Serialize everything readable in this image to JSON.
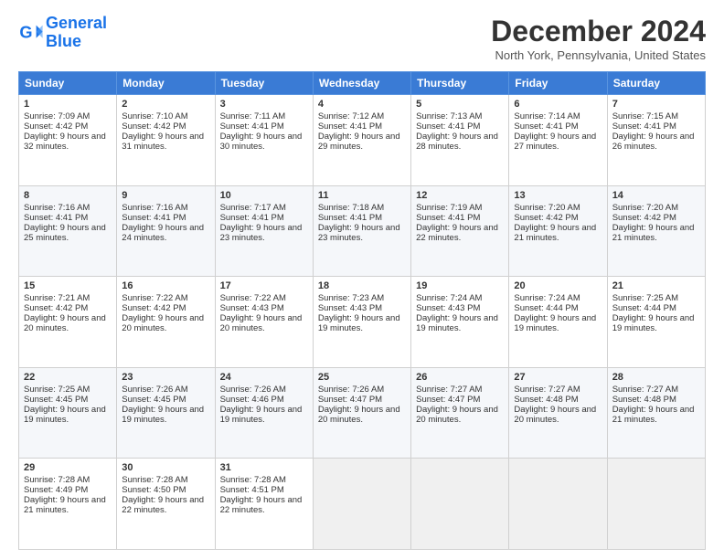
{
  "logo": {
    "line1": "General",
    "line2": "Blue"
  },
  "title": "December 2024",
  "location": "North York, Pennsylvania, United States",
  "headers": [
    "Sunday",
    "Monday",
    "Tuesday",
    "Wednesday",
    "Thursday",
    "Friday",
    "Saturday"
  ],
  "weeks": [
    [
      {
        "day": "1",
        "rise": "Sunrise: 7:09 AM",
        "set": "Sunset: 4:42 PM",
        "daylight": "Daylight: 9 hours and 32 minutes."
      },
      {
        "day": "2",
        "rise": "Sunrise: 7:10 AM",
        "set": "Sunset: 4:42 PM",
        "daylight": "Daylight: 9 hours and 31 minutes."
      },
      {
        "day": "3",
        "rise": "Sunrise: 7:11 AM",
        "set": "Sunset: 4:41 PM",
        "daylight": "Daylight: 9 hours and 30 minutes."
      },
      {
        "day": "4",
        "rise": "Sunrise: 7:12 AM",
        "set": "Sunset: 4:41 PM",
        "daylight": "Daylight: 9 hours and 29 minutes."
      },
      {
        "day": "5",
        "rise": "Sunrise: 7:13 AM",
        "set": "Sunset: 4:41 PM",
        "daylight": "Daylight: 9 hours and 28 minutes."
      },
      {
        "day": "6",
        "rise": "Sunrise: 7:14 AM",
        "set": "Sunset: 4:41 PM",
        "daylight": "Daylight: 9 hours and 27 minutes."
      },
      {
        "day": "7",
        "rise": "Sunrise: 7:15 AM",
        "set": "Sunset: 4:41 PM",
        "daylight": "Daylight: 9 hours and 26 minutes."
      }
    ],
    [
      {
        "day": "8",
        "rise": "Sunrise: 7:16 AM",
        "set": "Sunset: 4:41 PM",
        "daylight": "Daylight: 9 hours and 25 minutes."
      },
      {
        "day": "9",
        "rise": "Sunrise: 7:16 AM",
        "set": "Sunset: 4:41 PM",
        "daylight": "Daylight: 9 hours and 24 minutes."
      },
      {
        "day": "10",
        "rise": "Sunrise: 7:17 AM",
        "set": "Sunset: 4:41 PM",
        "daylight": "Daylight: 9 hours and 23 minutes."
      },
      {
        "day": "11",
        "rise": "Sunrise: 7:18 AM",
        "set": "Sunset: 4:41 PM",
        "daylight": "Daylight: 9 hours and 23 minutes."
      },
      {
        "day": "12",
        "rise": "Sunrise: 7:19 AM",
        "set": "Sunset: 4:41 PM",
        "daylight": "Daylight: 9 hours and 22 minutes."
      },
      {
        "day": "13",
        "rise": "Sunrise: 7:20 AM",
        "set": "Sunset: 4:42 PM",
        "daylight": "Daylight: 9 hours and 21 minutes."
      },
      {
        "day": "14",
        "rise": "Sunrise: 7:20 AM",
        "set": "Sunset: 4:42 PM",
        "daylight": "Daylight: 9 hours and 21 minutes."
      }
    ],
    [
      {
        "day": "15",
        "rise": "Sunrise: 7:21 AM",
        "set": "Sunset: 4:42 PM",
        "daylight": "Daylight: 9 hours and 20 minutes."
      },
      {
        "day": "16",
        "rise": "Sunrise: 7:22 AM",
        "set": "Sunset: 4:42 PM",
        "daylight": "Daylight: 9 hours and 20 minutes."
      },
      {
        "day": "17",
        "rise": "Sunrise: 7:22 AM",
        "set": "Sunset: 4:43 PM",
        "daylight": "Daylight: 9 hours and 20 minutes."
      },
      {
        "day": "18",
        "rise": "Sunrise: 7:23 AM",
        "set": "Sunset: 4:43 PM",
        "daylight": "Daylight: 9 hours and 19 minutes."
      },
      {
        "day": "19",
        "rise": "Sunrise: 7:24 AM",
        "set": "Sunset: 4:43 PM",
        "daylight": "Daylight: 9 hours and 19 minutes."
      },
      {
        "day": "20",
        "rise": "Sunrise: 7:24 AM",
        "set": "Sunset: 4:44 PM",
        "daylight": "Daylight: 9 hours and 19 minutes."
      },
      {
        "day": "21",
        "rise": "Sunrise: 7:25 AM",
        "set": "Sunset: 4:44 PM",
        "daylight": "Daylight: 9 hours and 19 minutes."
      }
    ],
    [
      {
        "day": "22",
        "rise": "Sunrise: 7:25 AM",
        "set": "Sunset: 4:45 PM",
        "daylight": "Daylight: 9 hours and 19 minutes."
      },
      {
        "day": "23",
        "rise": "Sunrise: 7:26 AM",
        "set": "Sunset: 4:45 PM",
        "daylight": "Daylight: 9 hours and 19 minutes."
      },
      {
        "day": "24",
        "rise": "Sunrise: 7:26 AM",
        "set": "Sunset: 4:46 PM",
        "daylight": "Daylight: 9 hours and 19 minutes."
      },
      {
        "day": "25",
        "rise": "Sunrise: 7:26 AM",
        "set": "Sunset: 4:47 PM",
        "daylight": "Daylight: 9 hours and 20 minutes."
      },
      {
        "day": "26",
        "rise": "Sunrise: 7:27 AM",
        "set": "Sunset: 4:47 PM",
        "daylight": "Daylight: 9 hours and 20 minutes."
      },
      {
        "day": "27",
        "rise": "Sunrise: 7:27 AM",
        "set": "Sunset: 4:48 PM",
        "daylight": "Daylight: 9 hours and 20 minutes."
      },
      {
        "day": "28",
        "rise": "Sunrise: 7:27 AM",
        "set": "Sunset: 4:48 PM",
        "daylight": "Daylight: 9 hours and 21 minutes."
      }
    ],
    [
      {
        "day": "29",
        "rise": "Sunrise: 7:28 AM",
        "set": "Sunset: 4:49 PM",
        "daylight": "Daylight: 9 hours and 21 minutes."
      },
      {
        "day": "30",
        "rise": "Sunrise: 7:28 AM",
        "set": "Sunset: 4:50 PM",
        "daylight": "Daylight: 9 hours and 22 minutes."
      },
      {
        "day": "31",
        "rise": "Sunrise: 7:28 AM",
        "set": "Sunset: 4:51 PM",
        "daylight": "Daylight: 9 hours and 22 minutes."
      },
      null,
      null,
      null,
      null
    ]
  ]
}
